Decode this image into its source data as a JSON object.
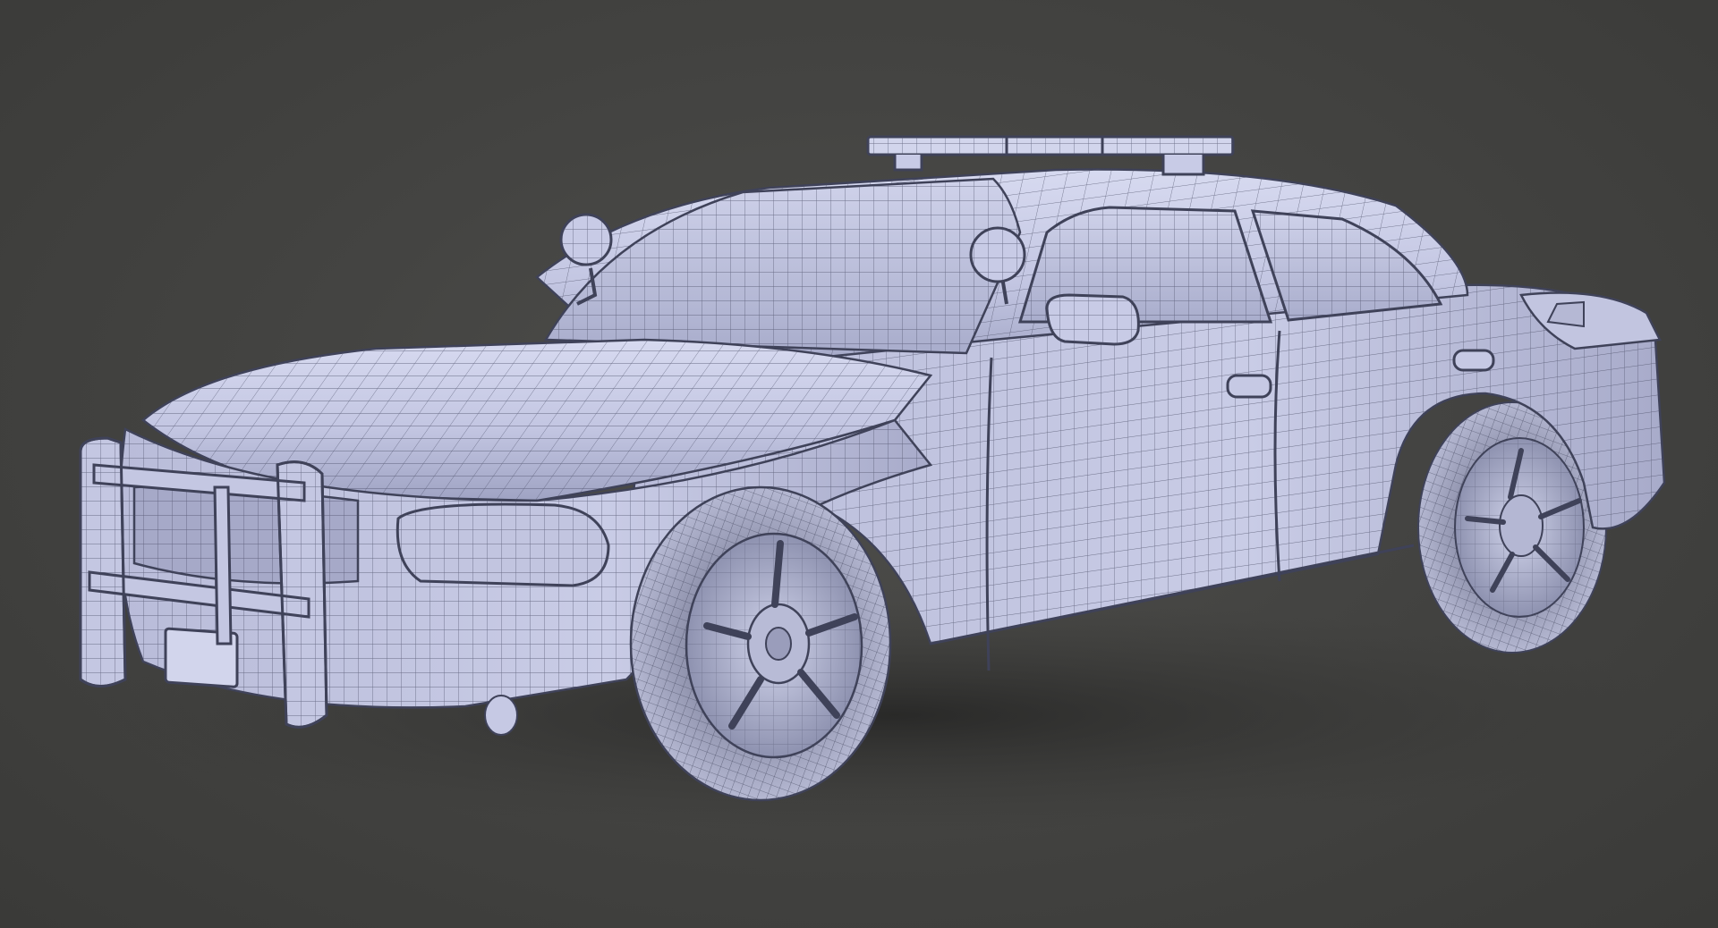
{
  "scene": {
    "subject": "police-car-wireframe-render",
    "colors": {
      "background": "#444442",
      "body": "#c8cbe6",
      "body_shadow": "#8f93b5",
      "wire": "#4a4d66",
      "glass": "#b9bdd9",
      "tire": "#9a9db6",
      "ground_shadow": "#2e2e2d"
    }
  }
}
